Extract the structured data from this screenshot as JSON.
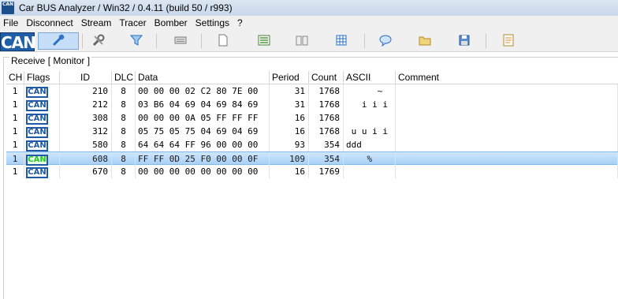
{
  "app": {
    "title": "Car BUS Analyzer / Win32 / 0.4.11 (build 50 / r993)",
    "icon_text": "CAN"
  },
  "menu": [
    "File",
    "Disconnect",
    "Stream",
    "Tracer",
    "Bomber",
    "Settings",
    "?"
  ],
  "toolbar": {
    "logo": "CAN",
    "icons": [
      "connect-icon",
      "tools-icon",
      "filter-icon",
      "keyboard-icon",
      "new-document-icon",
      "list-view-icon",
      "book-icon",
      "grid-icon",
      "chat-icon",
      "open-folder-icon",
      "save-icon",
      "notes-icon"
    ]
  },
  "group_label": "Receive [ Monitor ]",
  "columns": [
    "CH",
    "Flags",
    "ID",
    "DLC",
    "Data",
    "Period",
    "Count",
    "ASCII",
    "Comment"
  ],
  "rows": [
    {
      "ch": "1",
      "flag": "CAN",
      "id": "210",
      "dlc": "8",
      "data": "00 00 00 02 C2 80 7E 00",
      "period": "31",
      "count": "1768",
      "ascii": "      ~",
      "comment": "",
      "selected": false
    },
    {
      "ch": "1",
      "flag": "CAN",
      "id": "212",
      "dlc": "8",
      "data": "03 B6 04 69 04 69 84 69",
      "period": "31",
      "count": "1768",
      "ascii": "   i i i",
      "comment": "",
      "selected": false
    },
    {
      "ch": "1",
      "flag": "CAN",
      "id": "308",
      "dlc": "8",
      "data": "00 00 00 0A 05 FF FF FF",
      "period": "16",
      "count": "1768",
      "ascii": "",
      "comment": "",
      "selected": false
    },
    {
      "ch": "1",
      "flag": "CAN",
      "id": "312",
      "dlc": "8",
      "data": "05 75 05 75 04 69 04 69",
      "period": "16",
      "count": "1768",
      "ascii": " u u i i",
      "comment": "",
      "selected": false
    },
    {
      "ch": "1",
      "flag": "CAN",
      "id": "580",
      "dlc": "8",
      "data": "64 64 64 FF 96 00 00 00",
      "period": "93",
      "count": "354",
      "ascii": "ddd",
      "comment": "",
      "selected": false
    },
    {
      "ch": "1",
      "flag": "CAN",
      "id": "608",
      "dlc": "8",
      "data": "FF FF 0D 25 F0 00 00 0F",
      "period": "109",
      "count": "354",
      "ascii": "    %",
      "comment": "",
      "selected": true
    },
    {
      "ch": "1",
      "flag": "CAN",
      "id": "670",
      "dlc": "8",
      "data": "00 00 00 00 00 00 00 00",
      "period": "16",
      "count": "1769",
      "ascii": "",
      "comment": "",
      "selected": false
    }
  ]
}
